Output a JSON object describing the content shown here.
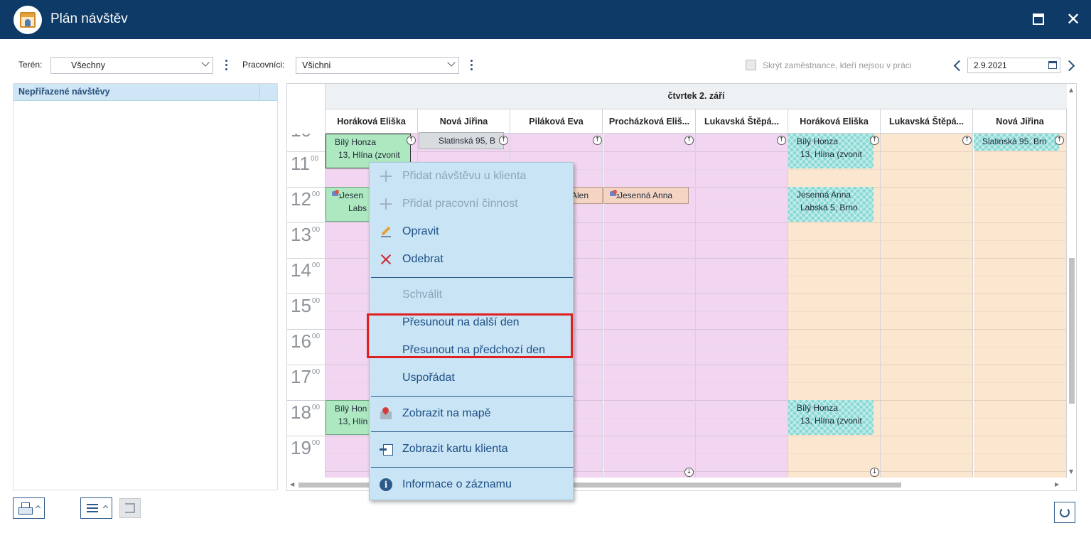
{
  "window": {
    "title": "Plán návštěv"
  },
  "filters": {
    "teren_label": "Terén:",
    "teren_value": "Všechny",
    "pracovnici_label": "Pracovníci:",
    "pracovnici_value": "Všichni",
    "hide_label": "Skrýt zaměstnance, kteří nejsou v práci",
    "date": "2.9.2021"
  },
  "left_panel": {
    "header": "Nepřiřazené návštěvy"
  },
  "scheduler": {
    "day": "čtvrtek 2. září",
    "columns": [
      {
        "name": "Horáková Eliška",
        "bg": "#f2d6f1"
      },
      {
        "name": "Nová Jiřina",
        "bg": "#f2d6f1"
      },
      {
        "name": "Piláková Eva",
        "bg": "#f2d6f1"
      },
      {
        "name": "Procházková Eliš...",
        "bg": "#f2d6f1"
      },
      {
        "name": "Lukavská Štěpá...",
        "bg": "#f2d6f1"
      },
      {
        "name": "Horáková Eliška",
        "bg": "#fbe6d0"
      },
      {
        "name": "Lukavská Štěpá...",
        "bg": "#fbe6d0"
      },
      {
        "name": "Nová Jiřina",
        "bg": "#fbe6d0"
      }
    ],
    "hours": [
      {
        "h": "11",
        "m": "00"
      },
      {
        "h": "12",
        "m": "00"
      },
      {
        "h": "13",
        "m": "00"
      },
      {
        "h": "14",
        "m": "00"
      },
      {
        "h": "15",
        "m": "00"
      },
      {
        "h": "16",
        "m": "00"
      },
      {
        "h": "17",
        "m": "00"
      },
      {
        "h": "18",
        "m": "00"
      },
      {
        "h": "19",
        "m": "00"
      }
    ],
    "events": [
      {
        "col": 0,
        "row": "10",
        "line1": "Bílý Honza",
        "line2": "13, Hlína (zvonit",
        "style": "green sel"
      },
      {
        "col": 1,
        "row": "10",
        "line1": "Slatinská 95, B",
        "line2": "",
        "style": "gray"
      },
      {
        "col": 0,
        "row": "12",
        "line1": "Jesen",
        "line2": "Labs",
        "style": "green",
        "badge": "1"
      },
      {
        "col": 2,
        "row": "12",
        "line1": "Alen",
        "line2": "",
        "style": "salmon"
      },
      {
        "col": 3,
        "row": "12",
        "line1": "Jesenná Anna",
        "line2": "",
        "style": "salmon",
        "badge": "2"
      },
      {
        "col": 5,
        "row": "10",
        "line1": "Bílý Honza",
        "line2": "13, Hlína (zvonit",
        "style": "teal"
      },
      {
        "col": 7,
        "row": "10",
        "line1": "Slatinská 95, Brn",
        "line2": "",
        "style": "teal"
      },
      {
        "col": 5,
        "row": "12",
        "line1": "Jesenná Anna",
        "line2": "Labská 5, Brno",
        "style": "teal"
      },
      {
        "col": 0,
        "row": "18",
        "line1": "Bílý Hon",
        "line2": "13, Hlín",
        "style": "green"
      },
      {
        "col": 5,
        "row": "18",
        "line1": "Bílý Honza",
        "line2": "13, Hlína (zvonit",
        "style": "teal"
      }
    ]
  },
  "context_menu": {
    "items": [
      {
        "label": "Přidat návštěvu u klienta",
        "icon": "plus-icon",
        "disabled": true
      },
      {
        "label": "Přidat pracovní činnost",
        "icon": "plus-icon",
        "disabled": true
      },
      {
        "label": "Opravit",
        "icon": "pencil-icon",
        "disabled": false
      },
      {
        "label": "Odebrat",
        "icon": "x-icon",
        "disabled": false
      },
      {
        "label": "Schválit",
        "icon": "",
        "disabled": true
      },
      {
        "label": "Přesunout na další den",
        "icon": "",
        "disabled": false
      },
      {
        "label": "Přesunout na předchozí den",
        "icon": "",
        "disabled": false
      },
      {
        "label": "Uspořádat",
        "icon": "",
        "disabled": false
      },
      {
        "label": "Zobrazit na mapě",
        "icon": "map-icon",
        "disabled": false
      },
      {
        "label": "Zobrazit kartu klienta",
        "icon": "card-icon",
        "disabled": false
      },
      {
        "label": "Informace o záznamu",
        "icon": "info-icon",
        "disabled": false
      }
    ]
  },
  "colors": {
    "titlebar": "#0d3a66",
    "menu_bg": "#c9e4f5",
    "highlight": "#e02020"
  }
}
